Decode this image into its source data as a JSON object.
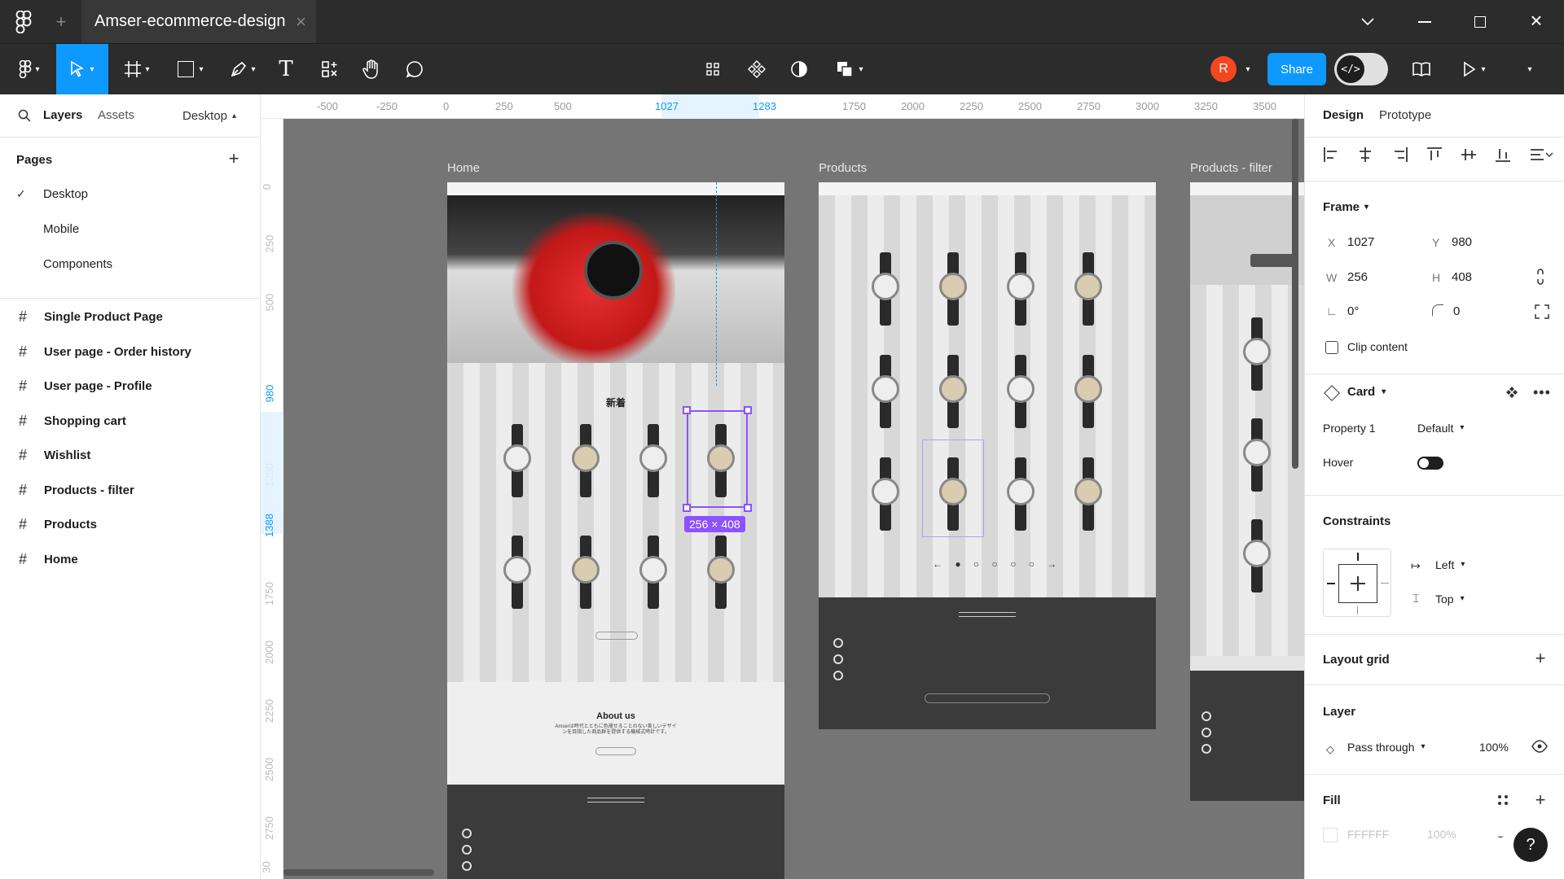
{
  "window": {
    "tab_title": "Amser-ecommerce-design"
  },
  "toolbar": {
    "avatar_letter": "R",
    "share_label": "Share",
    "zoom_label": ""
  },
  "left_panel": {
    "tabs": {
      "layers": "Layers",
      "assets": "Assets"
    },
    "page_selector": "Desktop",
    "pages_title": "Pages",
    "pages": [
      "Desktop",
      "Mobile",
      "Components"
    ],
    "layers": [
      "Single Product Page",
      "User page - Order history",
      "User page - Profile",
      "Shopping cart",
      "Wishlist",
      "Products - filter",
      "Products",
      "Home"
    ]
  },
  "ruler": {
    "top_ticks": [
      "-500",
      "-250",
      "0",
      "250",
      "500",
      "1027",
      "1283",
      "1750",
      "2000",
      "2250",
      "2500",
      "2750",
      "3000",
      "3250",
      "3500"
    ],
    "left_ticks": [
      "0",
      "250",
      "500",
      "980",
      "1250",
      "1388",
      "1750",
      "2000",
      "2250",
      "2500",
      "2750",
      "30"
    ]
  },
  "canvas": {
    "frames": [
      "Home",
      "Products",
      "Products - filter"
    ],
    "selection_size": "256 × 408",
    "home_section_title": "新着",
    "about_title": "About us",
    "about_text": "Amserは時代とともに色褪せることのない美しいデザインを目指した商品群を提供する機械式時計です。"
  },
  "right_panel": {
    "tabs": {
      "design": "Design",
      "prototype": "Prototype"
    },
    "frame": {
      "title": "Frame",
      "x_label": "X",
      "x": "1027",
      "y_label": "Y",
      "y": "980",
      "w_label": "W",
      "w": "256",
      "h_label": "H",
      "h": "408",
      "rotation": "0°",
      "radius": "0",
      "clip_content": "Clip content"
    },
    "component": {
      "name": "Card",
      "property_label": "Property 1",
      "property_value": "Default",
      "hover_label": "Hover"
    },
    "constraints": {
      "title": "Constraints",
      "horizontal": "Left",
      "vertical": "Top"
    },
    "layout_grid": "Layout grid",
    "layer": {
      "title": "Layer",
      "blend": "Pass through",
      "opacity": "100%"
    },
    "fill": {
      "title": "Fill",
      "hex": "FFFFFF",
      "opacity": "100%"
    }
  },
  "colors": {
    "accent": "#0d99ff",
    "selection": "#8c52ff",
    "share": "#0d99ff"
  }
}
